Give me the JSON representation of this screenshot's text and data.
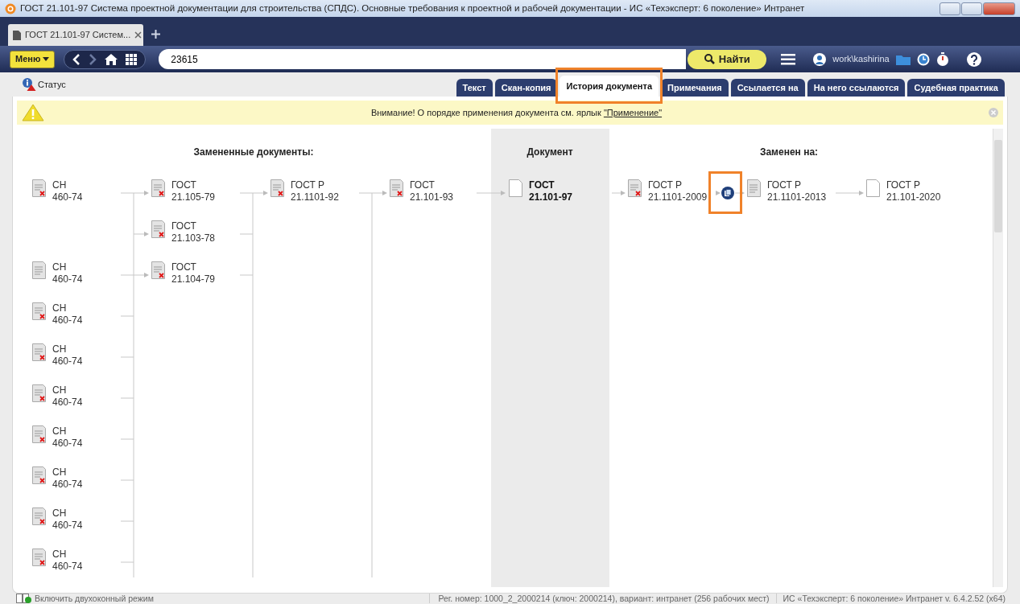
{
  "window": {
    "title": "ГОСТ 21.101-97 Система проектной документации для строительства (СПДС). Основные требования к проектной и рабочей документации - ИС «Техэксперт: 6 поколение» Интранет"
  },
  "browser_tabs": [
    {
      "label": "ГОСТ 21.101-97 Систем...",
      "selected": true
    }
  ],
  "toolbar": {
    "menu_label": "Меню",
    "search_value": "23615",
    "search_button": "Найти",
    "user": "work\\kashirina"
  },
  "status_label": "Статус",
  "doc_tabs": [
    {
      "label": "Текст",
      "selected": false,
      "highlighted": false
    },
    {
      "label": "Скан-копия",
      "selected": false,
      "highlighted": false
    },
    {
      "label": "История документа",
      "selected": true,
      "highlighted": true
    },
    {
      "label": "Примечания",
      "selected": false,
      "highlighted": false
    },
    {
      "label": "Ссылается на",
      "selected": false,
      "highlighted": false
    },
    {
      "label": "На него ссылаются",
      "selected": false,
      "highlighted": false
    },
    {
      "label": "Судебная практика",
      "selected": false,
      "highlighted": false
    }
  ],
  "notice": {
    "text": "Внимание! О порядке применения документа см. ярлык ",
    "link": "\"Применение\""
  },
  "history": {
    "replaced_heading": "Замененные документы:",
    "document_heading": "Документ",
    "replaced_by_heading": "Заменен на:",
    "document": {
      "title": "ГОСТ",
      "number": "21.101-97",
      "kind": "current"
    },
    "replaced": [
      {
        "title": "ГОСТ",
        "number": "21.101-93",
        "kind": "cancelled",
        "children": [
          {
            "title": "ГОСТ Р",
            "number": "21.1101-92",
            "kind": "cancelled",
            "children": [
              {
                "title": "ГОСТ",
                "number": "21.105-79",
                "kind": "cancelled",
                "children": [
                  {
                    "title": "СН",
                    "number": "460-74",
                    "kind": "cancelled"
                  }
                ]
              },
              {
                "title": "ГОСТ",
                "number": "21.103-78",
                "kind": "cancelled"
              },
              {
                "title": "ГОСТ",
                "number": "21.104-79",
                "kind": "cancelled",
                "children": [
                  {
                    "title": "СН",
                    "number": "460-74",
                    "kind": "inactive"
                  },
                  {
                    "title": "СН",
                    "number": "460-74",
                    "kind": "cancelled"
                  },
                  {
                    "title": "СН",
                    "number": "460-74",
                    "kind": "cancelled"
                  },
                  {
                    "title": "СН",
                    "number": "460-74",
                    "kind": "cancelled"
                  },
                  {
                    "title": "СН",
                    "number": "460-74",
                    "kind": "cancelled"
                  },
                  {
                    "title": "СН",
                    "number": "460-74",
                    "kind": "cancelled"
                  },
                  {
                    "title": "СН",
                    "number": "460-74",
                    "kind": "cancelled"
                  },
                  {
                    "title": "СН",
                    "number": "460-74",
                    "kind": "cancelled"
                  }
                ]
              }
            ]
          }
        ]
      }
    ],
    "replaced_by": [
      {
        "title": "ГОСТ Р",
        "number": "21.1101-2009",
        "kind": "cancelled",
        "connector": {
          "kind": "plain"
        }
      },
      {
        "title": "ГОСТ Р",
        "number": "21.1101-2013",
        "kind": "inactive",
        "connector": {
          "kind": "icon",
          "highlighted": true
        }
      },
      {
        "title": "ГОСТ Р",
        "number": "21.101-2020",
        "kind": "current",
        "connector": {
          "kind": "plain"
        }
      }
    ]
  },
  "status_bar": {
    "dual_mode": "Включить двухоконный режим",
    "registration": "Рег. номер: 1000_2_2000214 (ключ: 2000214), вариант: интранет (256 рабочих мест)",
    "version": "ИС «Техэксперт: 6 поколение» Интранет v. 6.4.2.52 (x64)"
  }
}
